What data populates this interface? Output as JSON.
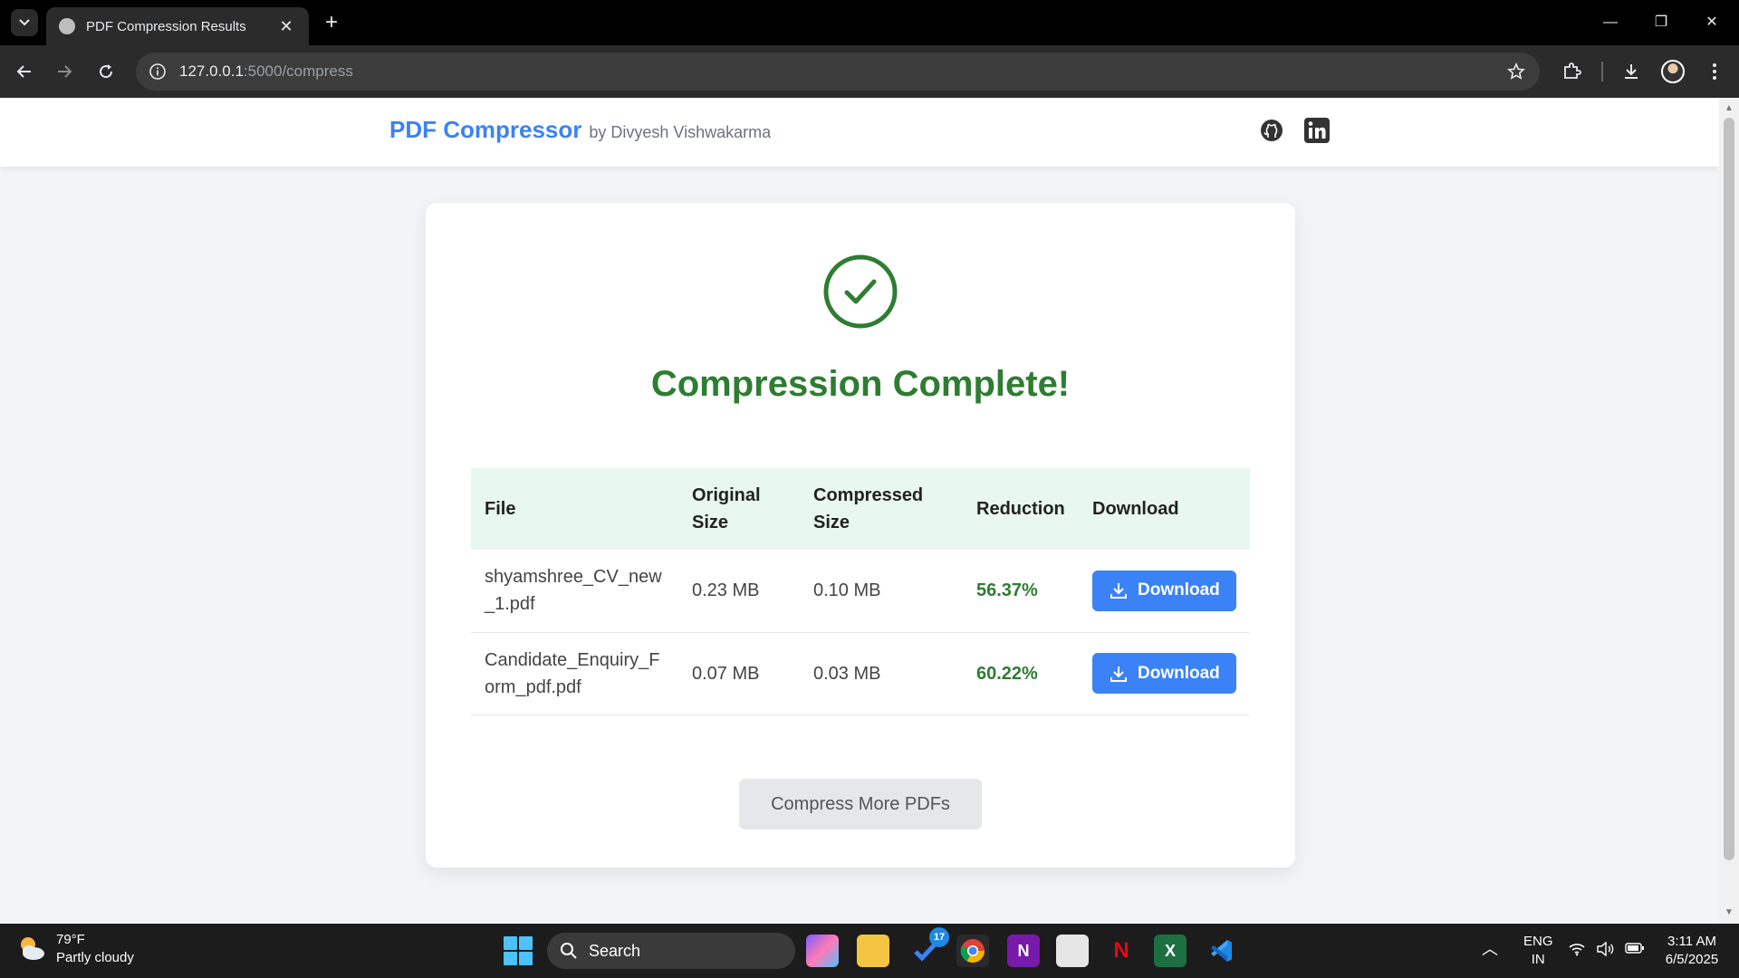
{
  "browser": {
    "tab_title": "PDF Compression Results",
    "url_host": "127.0.0.1",
    "url_rest": ":5000/compress"
  },
  "header": {
    "brand": "PDF Compressor",
    "byline": "by Divyesh Vishwakarma",
    "icons": [
      "github-icon",
      "linkedin-icon"
    ]
  },
  "main": {
    "headline": "Compression Complete!",
    "table": {
      "columns": [
        "File",
        "Original Size",
        "Compressed Size",
        "Reduction",
        "Download"
      ],
      "rows": [
        {
          "file": "shyamshree_CV_new_1.pdf",
          "original": "0.23 MB",
          "compressed": "0.10 MB",
          "reduction": "56.37%",
          "action": "Download"
        },
        {
          "file": "Candidate_Enquiry_Form_pdf.pdf",
          "original": "0.07 MB",
          "compressed": "0.03 MB",
          "reduction": "60.22%",
          "action": "Download"
        }
      ]
    },
    "more_button": "Compress More PDFs"
  },
  "colors": {
    "brand": "#3b82f6",
    "success": "#2e7d32",
    "table_header_bg": "#e8f7ef"
  },
  "taskbar": {
    "temperature": "79°F",
    "condition": "Partly cloudy",
    "search_label": "Search",
    "badge_count": "17",
    "lang_1": "ENG",
    "lang_2": "IN",
    "time": "3:11 AM",
    "date": "6/5/2025"
  }
}
